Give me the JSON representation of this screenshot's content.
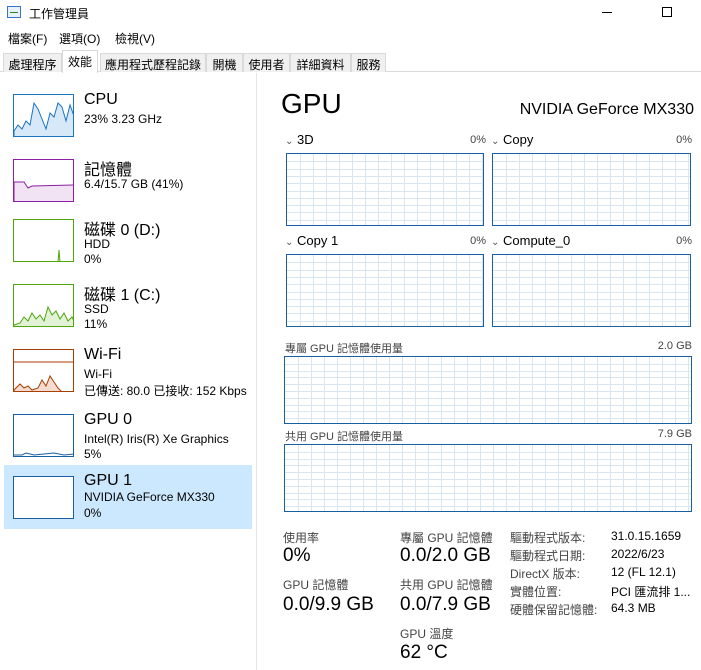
{
  "window": {
    "title": "工作管理員"
  },
  "menu": [
    "檔案(F)",
    "選項(O)",
    "檢視(V)"
  ],
  "tabs": [
    "處理程序",
    "效能",
    "應用程式歷程記錄",
    "開機",
    "使用者",
    "詳細資料",
    "服務"
  ],
  "colors": {
    "cpu": "#1b73c4",
    "memory": "#8b1fa0",
    "disk": "#4da60c",
    "wifi": "#a73e02",
    "gpu": "#1b5fa3",
    "selected_bg": "#cce8ff"
  },
  "sidebar": [
    {
      "name": "CPU",
      "line1": "23%  3.23 GHz",
      "line2": "",
      "line3": ""
    },
    {
      "name": "記憶體",
      "line1": "6.4/15.7 GB (41%)",
      "line2": "",
      "line3": ""
    },
    {
      "name": "磁碟 0 (D:)",
      "line1": "HDD",
      "line2": "0%",
      "line3": ""
    },
    {
      "name": "磁碟 1 (C:)",
      "line1": "SSD",
      "line2": "11%",
      "line3": ""
    },
    {
      "name": "Wi-Fi",
      "line1": "Wi-Fi",
      "line2": "已傳送: 80.0  已接收: 152 Kbps",
      "line3": ""
    },
    {
      "name": "GPU 0",
      "line1": "Intel(R) Iris(R) Xe Graphics",
      "line2": "5%",
      "line3": ""
    },
    {
      "name": "GPU 1",
      "line1": "NVIDIA GeForce MX330",
      "line2": "0%",
      "line3": ""
    }
  ],
  "main": {
    "title": "GPU",
    "model": "NVIDIA GeForce MX330",
    "engines": [
      {
        "label": "3D",
        "pct": "0%"
      },
      {
        "label": "Copy",
        "pct": "0%"
      },
      {
        "label": "Copy 1",
        "pct": "0%"
      },
      {
        "label": "Compute_0",
        "pct": "0%"
      }
    ],
    "dedicated": {
      "label": "專屬 GPU 記憶體使用量",
      "max": "2.0 GB"
    },
    "shared": {
      "label": "共用 GPU 記憶體使用量",
      "max": "7.9 GB"
    }
  },
  "stats": {
    "utilization": {
      "label": "使用率",
      "value": "0%"
    },
    "gpu_memory": {
      "label": "GPU 記憶體",
      "value": "0.0/9.9 GB"
    },
    "dedicated_mem": {
      "label": "專屬 GPU 記憶體",
      "value": "0.0/2.0 GB"
    },
    "shared_mem": {
      "label": "共用 GPU 記憶體",
      "value": "0.0/7.9 GB"
    },
    "temperature": {
      "label": "GPU 溫度",
      "value": "62 °C"
    }
  },
  "info": [
    {
      "label": "驅動程式版本:",
      "value": "31.0.15.1659"
    },
    {
      "label": "驅動程式日期:",
      "value": "2022/6/23"
    },
    {
      "label": "DirectX 版本:",
      "value": "12 (FL 12.1)"
    },
    {
      "label": "實體位置:",
      "value": "PCI 匯流排 1..."
    },
    {
      "label": "硬體保留記憶體:",
      "value": "64.3 MB"
    }
  ]
}
